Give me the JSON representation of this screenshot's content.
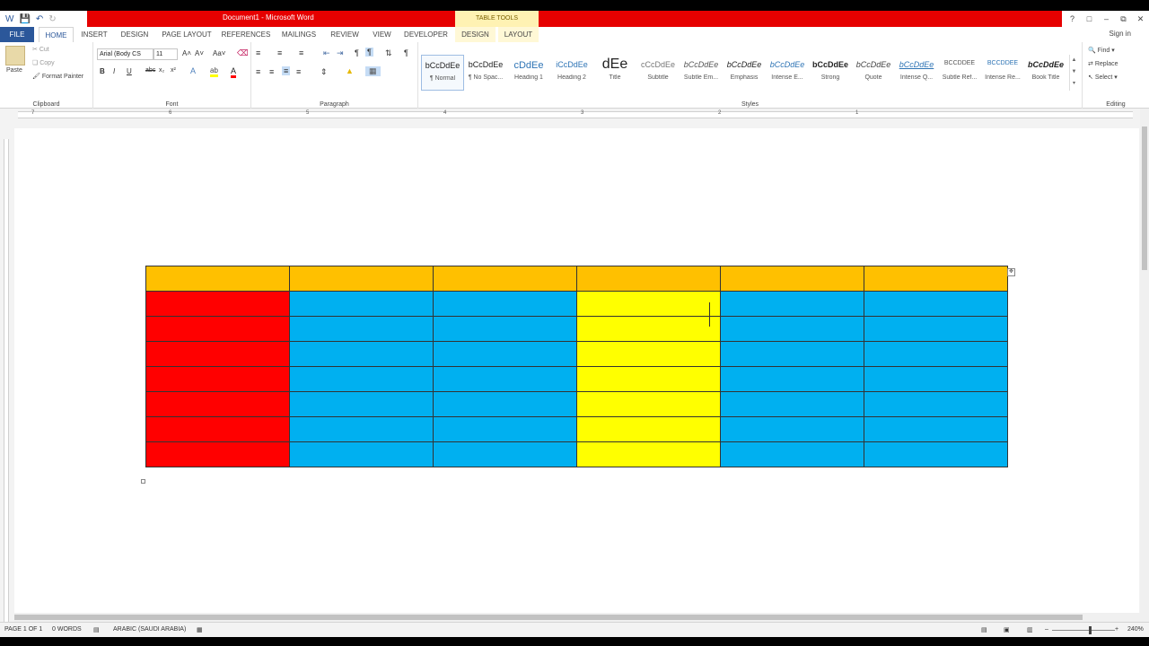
{
  "window": {
    "title": "Document1 - Microsoft Word",
    "contextual_header": "TABLE TOOLS",
    "signin": "Sign in",
    "brand_color": "#2b579a",
    "title_band_color": "#e60000"
  },
  "tabs": [
    {
      "label": "FILE"
    },
    {
      "label": "HOME"
    },
    {
      "label": "INSERT"
    },
    {
      "label": "DESIGN"
    },
    {
      "label": "PAGE LAYOUT"
    },
    {
      "label": "REFERENCES"
    },
    {
      "label": "MAILINGS"
    },
    {
      "label": "REVIEW"
    },
    {
      "label": "VIEW"
    },
    {
      "label": "DEVELOPER"
    },
    {
      "label": "DESIGN"
    },
    {
      "label": "LAYOUT"
    }
  ],
  "ribbon": {
    "clipboard": {
      "label": "Clipboard",
      "paste": "Paste",
      "cut": "Cut",
      "copy": "Copy",
      "format_painter": "Format Painter"
    },
    "font": {
      "label": "Font",
      "font_name": "Arial (Body CS",
      "font_size": "11"
    },
    "paragraph": {
      "label": "Paragraph"
    },
    "styles": {
      "label": "Styles",
      "items": [
        {
          "sample": "bCcDdEe",
          "name": "¶ Normal"
        },
        {
          "sample": "bCcDdEe",
          "name": "¶ No Spac..."
        },
        {
          "sample": "cDdEe",
          "name": "Heading 1"
        },
        {
          "sample": "iCcDdEe",
          "name": "Heading 2"
        },
        {
          "sample": "dEe",
          "name": "Title"
        },
        {
          "sample": "cCcDdEe",
          "name": "Subtitle"
        },
        {
          "sample": "bCcDdEe",
          "name": "Subtle Em..."
        },
        {
          "sample": "bCcDdEe",
          "name": "Emphasis"
        },
        {
          "sample": "bCcDdEe",
          "name": "Intense E..."
        },
        {
          "sample": "bCcDdEe",
          "name": "Strong"
        },
        {
          "sample": "bCcDdEe",
          "name": "Quote"
        },
        {
          "sample": "bCcDdEe",
          "name": "Intense Q..."
        },
        {
          "sample": "BCCDDEE",
          "name": "Subtle Ref..."
        },
        {
          "sample": "BCCDDEE",
          "name": "Intense Re..."
        },
        {
          "sample": "bCcDdEe",
          "name": "Book Title"
        }
      ]
    },
    "editing": {
      "label": "Editing",
      "find": "Find",
      "replace": "Replace",
      "select": "Select"
    }
  },
  "ruler": {
    "numbers": [
      "7",
      "6",
      "5",
      "4",
      "3",
      "2",
      "1"
    ]
  },
  "table": {
    "colors": {
      "header": "#ffc000",
      "first_column": "#ff0000",
      "body": "#00b0f0",
      "highlight_column": "#ffff00"
    },
    "rows": 8,
    "columns": 6
  },
  "statusbar": {
    "page": "PAGE 1 OF 1",
    "words": "0 WORDS",
    "language": "ARABIC (SAUDI ARABIA)",
    "zoom": "240%"
  }
}
